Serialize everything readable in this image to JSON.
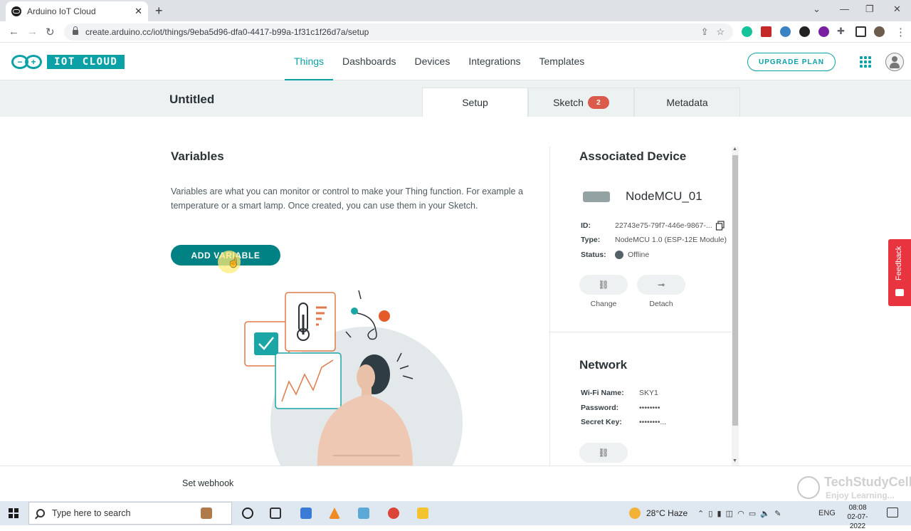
{
  "browser": {
    "tab_title": "Arduino IoT Cloud",
    "url": "create.arduino.cc/iot/things/9eba5d96-dfa0-4417-b99a-1f31c1f26d7a/setup"
  },
  "header": {
    "logo_text": "IOT CLOUD",
    "nav": [
      "Things",
      "Dashboards",
      "Devices",
      "Integrations",
      "Templates"
    ],
    "active_nav": "Things",
    "upgrade_label": "UPGRADE PLAN"
  },
  "thing": {
    "title": "Untitled",
    "tabs": {
      "setup": "Setup",
      "sketch": "Sketch",
      "sketch_count": "2",
      "metadata": "Metadata"
    }
  },
  "variables": {
    "title": "Variables",
    "description": "Variables are what you can monitor or control to make your Thing function. For example a temperature or a smart lamp. Once created, you can use them in your Sketch.",
    "add_label": "ADD VARIABLE"
  },
  "device": {
    "section_title": "Associated Device",
    "name": "NodeMCU_01",
    "id_label": "ID:",
    "id_value": "22743e75-79f7-446e-9867-...",
    "type_label": "Type:",
    "type_value": "NodeMCU 1.0 (ESP-12E Module)",
    "status_label": "Status:",
    "status_value": "Offline",
    "change_label": "Change",
    "detach_label": "Detach"
  },
  "network": {
    "section_title": "Network",
    "wifi_label": "Wi-Fi Name:",
    "wifi_value": "SKY1",
    "password_label": "Password:",
    "password_value": "••••••••",
    "secret_label": "Secret Key:",
    "secret_value": "••••••••..."
  },
  "feedback_label": "Feedback",
  "footer": {
    "webhook_label": "Set webhook"
  },
  "watermark": {
    "name": "TechStudyCell",
    "tagline": "Enjoy Learning..."
  },
  "taskbar": {
    "search_placeholder": "Type here to search",
    "weather": "28°C  Haze",
    "language": "ENG",
    "time": "08:08",
    "date": "02-07-2022"
  },
  "colors": {
    "accent": "#0ca1a6",
    "button": "#008184",
    "badge": "#da5b4a",
    "feedback": "#e8343f"
  }
}
